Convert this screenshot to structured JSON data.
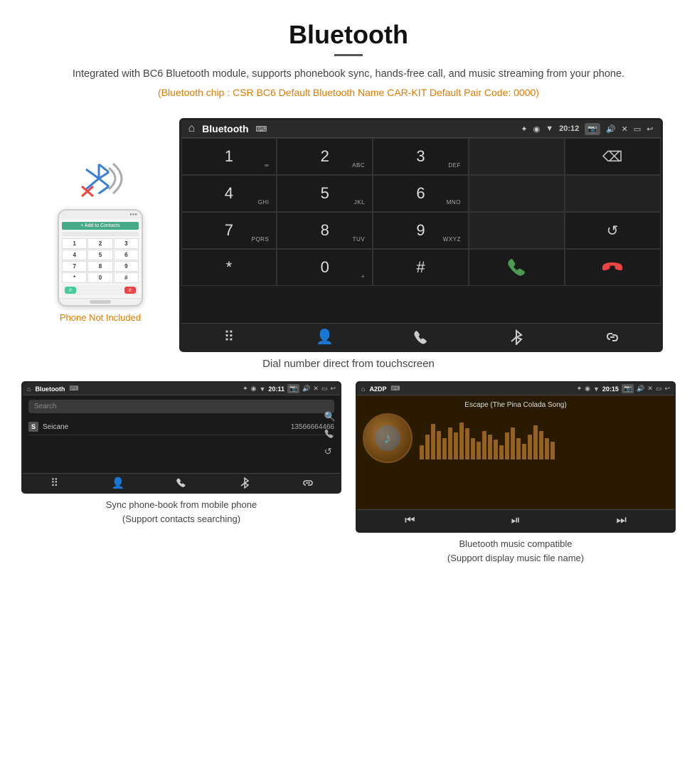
{
  "page": {
    "title": "Bluetooth",
    "description": "Integrated with BC6 Bluetooth module, supports phonebook sync, hands-free call, and music streaming from your phone.",
    "info_line": "(Bluetooth chip : CSR BC6    Default Bluetooth Name CAR-KIT    Default Pair Code: 0000)",
    "main_caption": "Dial number direct from touchscreen"
  },
  "phone_side": {
    "not_included": "Phone Not Included"
  },
  "car_screen": {
    "status_bar": {
      "home": "⌂",
      "title": "Bluetooth",
      "usb": "⌨",
      "bt": "✦",
      "location": "◉",
      "signal": "▼",
      "time": "20:12",
      "camera": "📷",
      "volume": "🔊",
      "close": "✕",
      "window": "▭",
      "back": "↩"
    },
    "dialpad": {
      "keys": [
        {
          "label": "1",
          "sub": "∞"
        },
        {
          "label": "2",
          "sub": "ABC"
        },
        {
          "label": "3",
          "sub": "DEF"
        },
        {
          "label": "",
          "sub": ""
        },
        {
          "label": "⌫",
          "sub": ""
        },
        {
          "label": "4",
          "sub": "GHI"
        },
        {
          "label": "5",
          "sub": "JKL"
        },
        {
          "label": "6",
          "sub": "MNO"
        },
        {
          "label": "",
          "sub": ""
        },
        {
          "label": "",
          "sub": ""
        },
        {
          "label": "7",
          "sub": "PQRS"
        },
        {
          "label": "8",
          "sub": "TUV"
        },
        {
          "label": "9",
          "sub": "WXYZ"
        },
        {
          "label": "",
          "sub": ""
        },
        {
          "label": "↺",
          "sub": ""
        },
        {
          "label": "*",
          "sub": ""
        },
        {
          "label": "0",
          "sub": "+"
        },
        {
          "label": "#",
          "sub": ""
        },
        {
          "label": "📞",
          "sub": ""
        },
        {
          "label": "📵",
          "sub": ""
        }
      ]
    },
    "bottom_icons": [
      "⠿",
      "👤",
      "📞",
      "✦",
      "🔗"
    ]
  },
  "phonebook_screen": {
    "status_bar_title": "Bluetooth",
    "time": "20:11",
    "search_placeholder": "Search",
    "entries": [
      {
        "letter": "S",
        "name": "Seicane",
        "phone": "13566664466"
      }
    ],
    "bottom_icons": [
      "⠿",
      "👤",
      "📞",
      "✦",
      "🔗"
    ],
    "caption_line1": "Sync phone-book from mobile phone",
    "caption_line2": "(Support contacts searching)"
  },
  "music_screen": {
    "status_bar_title": "A2DP",
    "time": "20:15",
    "song_title": "Escape (The Pina Colada Song)",
    "viz_heights": [
      20,
      35,
      50,
      40,
      30,
      45,
      38,
      52,
      44,
      30,
      25,
      40,
      35,
      28,
      20,
      38,
      45,
      30,
      22,
      35,
      48,
      40,
      30,
      25
    ],
    "controls": [
      "⏮",
      "⏯",
      "⏭"
    ],
    "caption_line1": "Bluetooth music compatible",
    "caption_line2": "(Support display music file name)"
  }
}
